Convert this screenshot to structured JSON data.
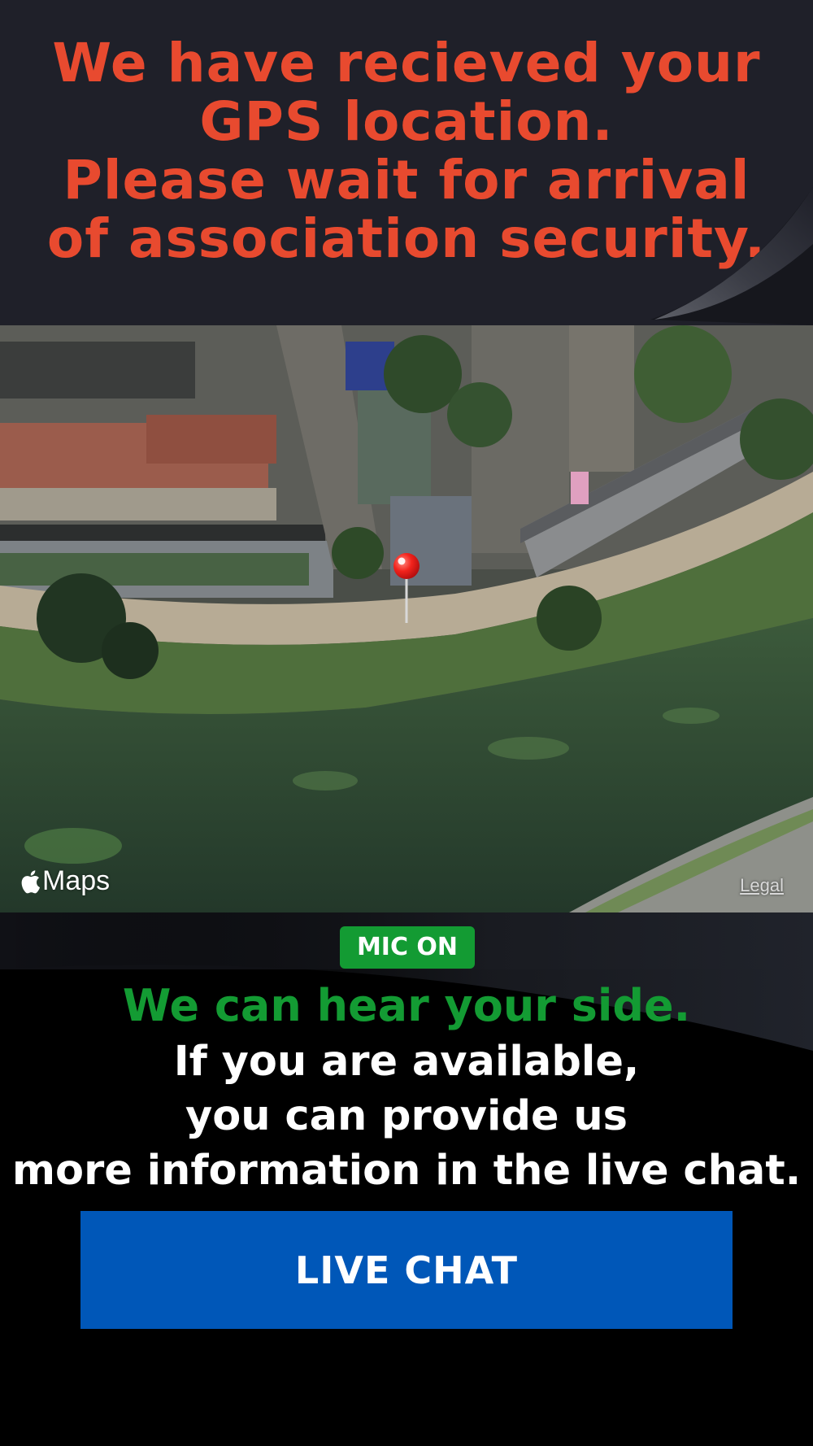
{
  "header": {
    "lines": [
      "We have recieved your",
      "GPS location.",
      "Please wait for arrival",
      "of association security."
    ],
    "color": "#e84a2f",
    "background": "#1f2029"
  },
  "map": {
    "attribution": "Maps",
    "apple_icon": "apple-logo-icon",
    "legal_label": "Legal",
    "pin_icon": "map-pin-icon"
  },
  "status": {
    "mic_badge": "MIC ON",
    "mic_color": "#139b33",
    "heard_message": "We can hear your side."
  },
  "info": {
    "lines": [
      "If you are available,",
      "you can provide us",
      "more information in the live chat."
    ]
  },
  "actions": {
    "live_chat_label": "LIVE CHAT",
    "button_color": "#0057b8"
  }
}
